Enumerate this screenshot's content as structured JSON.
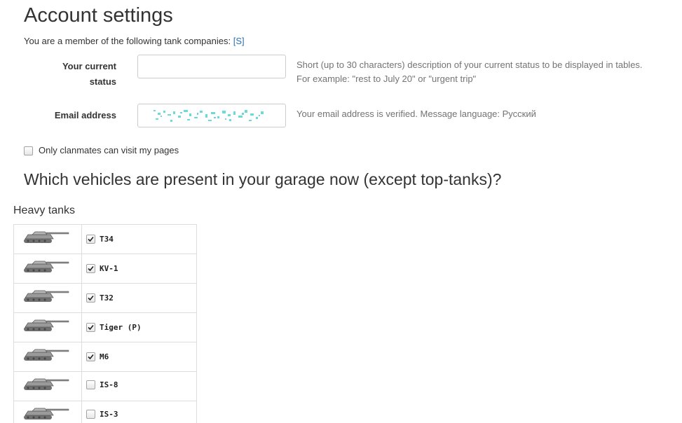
{
  "page": {
    "title": "Account settings",
    "membership_text": "You are a member of the following tank companies:",
    "membership_link": "[S]"
  },
  "form": {
    "status_label": "Your current status",
    "status_value": "",
    "status_help_line1": "Short (up to 30 characters) description of your current status to be displayed in tables.",
    "status_help_line2": "For example: \"rest to July 20\" or \"urgent trip\"",
    "email_label": "Email address",
    "email_help": "Your email address is verified. Message language: Русский",
    "clan_only_label": "Only clanmates can visit my pages",
    "clan_only_checked": false
  },
  "garage": {
    "question": "Which vehicles are present in your garage now (except top-tanks)?",
    "section": "Heavy tanks",
    "tanks": [
      {
        "name": "T34",
        "checked": true,
        "icon": "heavy-tank-icon"
      },
      {
        "name": "KV-1",
        "checked": true,
        "icon": "heavy-tank-icon"
      },
      {
        "name": "T32",
        "checked": true,
        "icon": "heavy-tank-icon"
      },
      {
        "name": "Tiger (P)",
        "checked": true,
        "icon": "heavy-tank-icon"
      },
      {
        "name": "M6",
        "checked": true,
        "icon": "heavy-tank-icon"
      },
      {
        "name": "IS-8",
        "checked": false,
        "icon": "heavy-tank-icon"
      },
      {
        "name": "IS-3",
        "checked": false,
        "icon": "heavy-tank-icon"
      }
    ]
  },
  "colors": {
    "link": "#2a6fb6",
    "help_text": "#737373",
    "border": "#dddddd"
  }
}
